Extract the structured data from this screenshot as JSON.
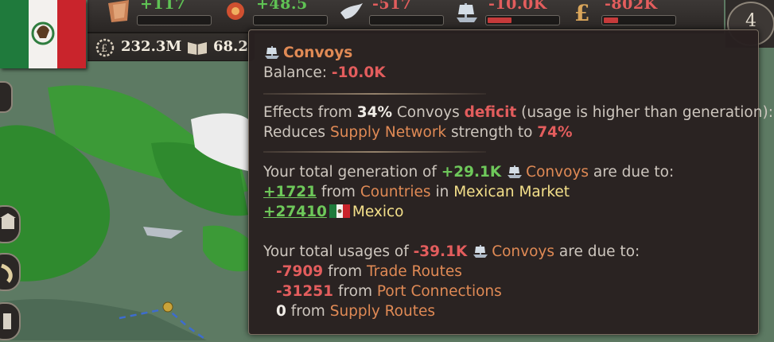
{
  "topbar": {
    "resources": [
      {
        "icon": "bullion-icon",
        "value": "+117",
        "color": "#5fc254",
        "fill": 0
      },
      {
        "icon": "influence-icon",
        "value": "+48.5",
        "color": "#5fc254",
        "fill": 0
      },
      {
        "icon": "peace-dove-icon",
        "value": "-517",
        "color": "#e35d5d",
        "fill": 0
      },
      {
        "icon": "ship-icon",
        "value": "-10.0K",
        "color": "#e35d5d",
        "fill": 0.34
      },
      {
        "icon": "pound-icon",
        "value": "-802K",
        "color": "#e35d5d",
        "fill": 0.2
      }
    ],
    "gdp": "232.3M",
    "literacy": "68.2",
    "alert_count": "4"
  },
  "tooltip": {
    "title": "Convoys",
    "balance_label": "Balance:",
    "balance_value": "-10.0K",
    "effects_prefix": "Effects from",
    "effects_pct": "34%",
    "effects_mid": "Convoys",
    "effects_deficit": "deficit",
    "effects_suffix": "(usage is higher than generation):",
    "reduces_prefix": "Reduces",
    "reduces_link": "Supply Network",
    "reduces_mid": "strength to",
    "reduces_pct": "74%",
    "gen_prefix": "Your total generation of",
    "gen_value": "+29.1K",
    "gen_link": "Convoys",
    "gen_suffix": "are due to:",
    "gen_rows": [
      {
        "value": "+1721",
        "from": "from",
        "link": "Countries",
        "in": "in",
        "market": "Mexican Market"
      },
      {
        "value": "+27410",
        "name": "Mexico"
      }
    ],
    "use_prefix": "Your total usages of",
    "use_value": "-39.1K",
    "use_link": "Convoys",
    "use_suffix": "are due to:",
    "use_rows": [
      {
        "value": "-7909",
        "from": "from",
        "link": "Trade Routes"
      },
      {
        "value": "-31251",
        "from": "from",
        "link": "Port Connections"
      },
      {
        "value": "0",
        "from": "from",
        "link": "Supply Routes"
      }
    ]
  }
}
